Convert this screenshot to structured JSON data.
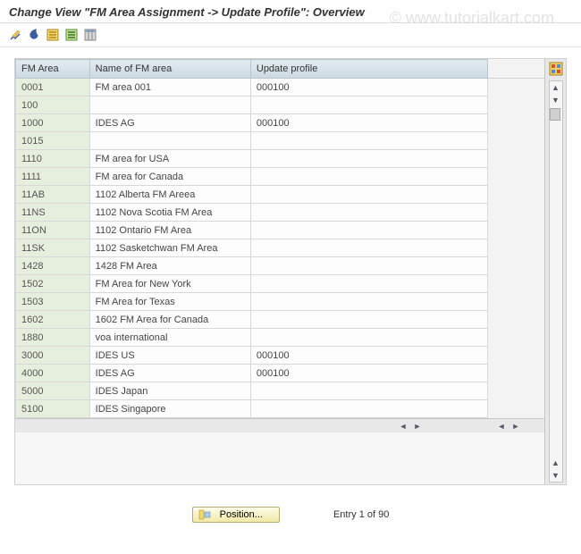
{
  "title": "Change View \"FM Area Assignment -> Update Profile\": Overview",
  "watermark": "© www.tutorialkart.com",
  "columns": {
    "fm_area": "FM Area",
    "name": "Name of FM area",
    "profile": "Update profile"
  },
  "rows": [
    {
      "fm_area": "0001",
      "name": "FM area 001",
      "profile": "000100"
    },
    {
      "fm_area": "100",
      "name": "",
      "profile": ""
    },
    {
      "fm_area": "1000",
      "name": "IDES AG",
      "profile": "000100"
    },
    {
      "fm_area": "1015",
      "name": "",
      "profile": ""
    },
    {
      "fm_area": "1110",
      "name": "FM area for USA",
      "profile": ""
    },
    {
      "fm_area": "1111",
      "name": "FM area for Canada",
      "profile": ""
    },
    {
      "fm_area": "11AB",
      "name": "1102 Alberta FM Areea",
      "profile": ""
    },
    {
      "fm_area": "11NS",
      "name": "1102 Nova Scotia FM Area",
      "profile": ""
    },
    {
      "fm_area": "11ON",
      "name": "1102 Ontario FM Area",
      "profile": ""
    },
    {
      "fm_area": "11SK",
      "name": "1102 Sasketchwan FM Area",
      "profile": ""
    },
    {
      "fm_area": "1428",
      "name": "1428 FM Area",
      "profile": ""
    },
    {
      "fm_area": "1502",
      "name": "FM Area for New York",
      "profile": ""
    },
    {
      "fm_area": "1503",
      "name": "FM Area for Texas",
      "profile": ""
    },
    {
      "fm_area": "1602",
      "name": "1602 FM Area for Canada",
      "profile": ""
    },
    {
      "fm_area": "1880",
      "name": "voa international",
      "profile": ""
    },
    {
      "fm_area": "3000",
      "name": "IDES US",
      "profile": "000100"
    },
    {
      "fm_area": "4000",
      "name": "IDES AG",
      "profile": "000100"
    },
    {
      "fm_area": "5000",
      "name": "IDES Japan",
      "profile": ""
    },
    {
      "fm_area": "5100",
      "name": "IDES Singapore",
      "profile": ""
    }
  ],
  "footer": {
    "position_label": "Position...",
    "entry_text": "Entry 1 of 90"
  }
}
